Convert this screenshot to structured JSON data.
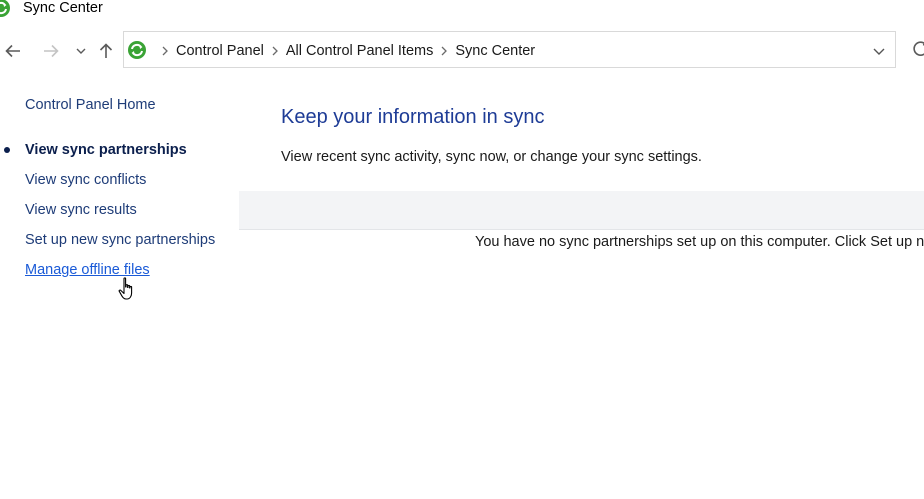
{
  "window": {
    "title": "Sync Center"
  },
  "nav": {
    "back_icon": "back-arrow-icon",
    "forward_icon": "forward-arrow-icon",
    "recent_icon": "chevron-down-icon",
    "up_icon": "up-arrow-icon",
    "breadcrumbs": [
      "Control Panel",
      "All Control Panel Items",
      "Sync Center"
    ],
    "refresh_icon": "refresh-icon"
  },
  "sidebar": {
    "home_label": "Control Panel Home",
    "tasks": [
      {
        "label": "View sync partnerships",
        "state": "current"
      },
      {
        "label": "View sync conflicts",
        "state": "normal"
      },
      {
        "label": "View sync results",
        "state": "normal"
      },
      {
        "label": "Set up new sync partnerships",
        "state": "normal"
      },
      {
        "label": "Manage offline files",
        "state": "hover"
      }
    ]
  },
  "main": {
    "heading": "Keep your information in sync",
    "description": "View recent sync activity, sync now, or change your sync settings.",
    "empty_message": "You have no sync partnerships set up on this computer. Click Set up n"
  },
  "colors": {
    "link": "#1e3c78",
    "link_hover": "#1a5ad7",
    "heading": "#1e3c96",
    "toolbar_bg": "#f3f4f6",
    "sync_icon_green": "#3aa335"
  }
}
